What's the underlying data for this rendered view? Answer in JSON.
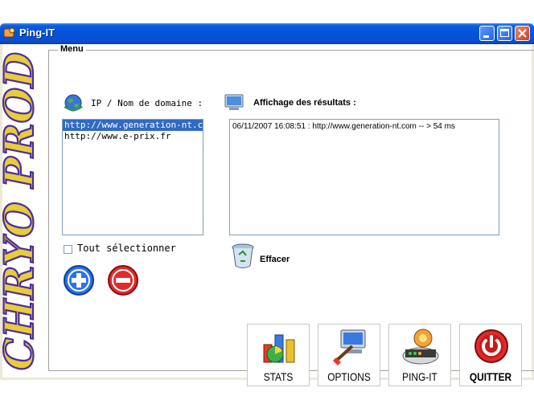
{
  "window": {
    "title": "Ping-IT"
  },
  "sidebar": {
    "logo_text": "CHRYO PROD"
  },
  "menu": {
    "legend": "Menu"
  },
  "hosts": {
    "label": "IP / Nom de domaine :",
    "items": [
      "http://www.generation-nt.com",
      "http://www.e-prix.fr"
    ],
    "selected_index": 0,
    "select_all_label": "Tout sélectionner",
    "select_all_checked": false
  },
  "results": {
    "label": "Affichage des résultats :",
    "lines": [
      "06/11/2007 16:08:51 : http://www.generation-nt.com -- > 54 ms"
    ],
    "clear_label": "Effacer"
  },
  "actions": {
    "stats": "STATS",
    "options": "OPTIONS",
    "ping": "PING-IT",
    "quit": "QUITTER"
  },
  "colors": {
    "titlebar": "#0553d8",
    "selection": "#316ac5",
    "logo_fill": "#e8cc3a",
    "logo_stroke": "#4b2c9c"
  }
}
